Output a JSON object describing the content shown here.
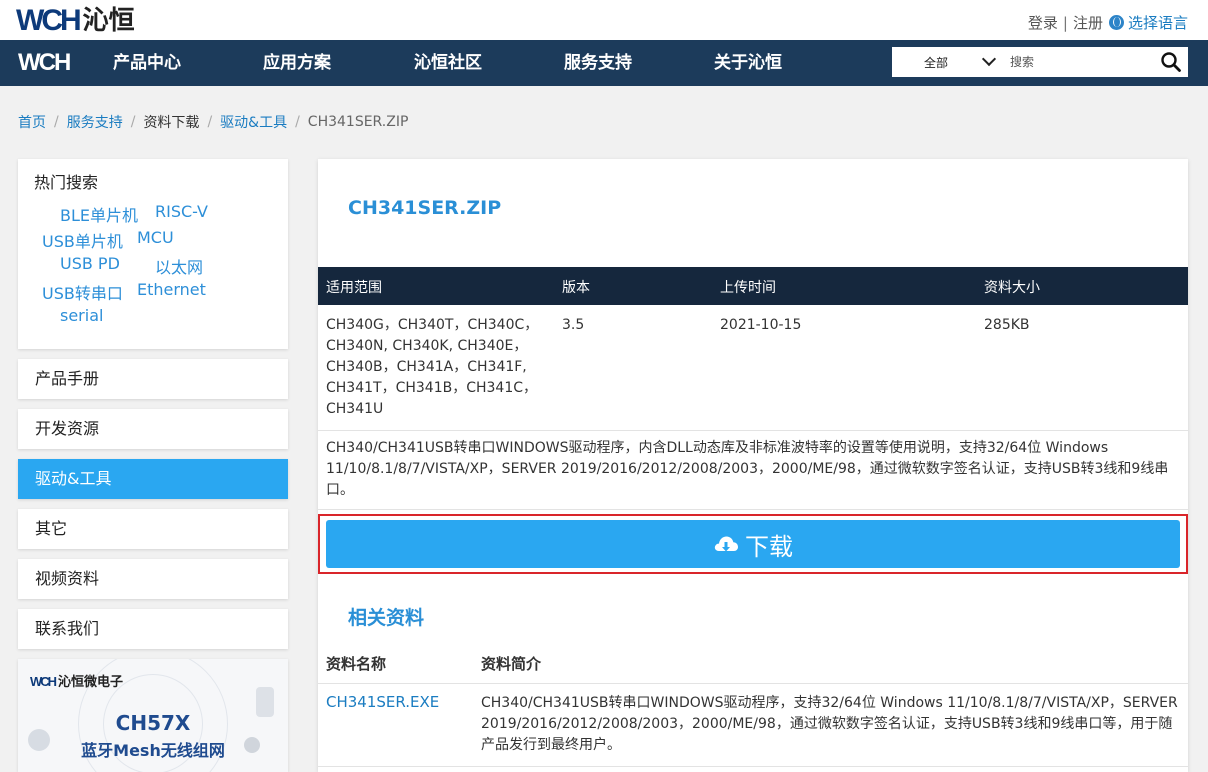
{
  "brand": {
    "logo_mark": "WCH",
    "logo_text": "沁恒"
  },
  "header": {
    "login": "登录",
    "separator": "|",
    "register": "注册",
    "language": "选择语言"
  },
  "nav": {
    "logo_mark": "WCH",
    "items": [
      "产品中心",
      "应用方案",
      "沁恒社区",
      "服务支持",
      "关于沁恒"
    ],
    "search": {
      "scope": "全部",
      "placeholder": "搜索",
      "value": ""
    }
  },
  "breadcrumb": [
    "首页",
    "服务支持",
    "资料下载",
    "驱动&工具",
    "CH341SER.ZIP"
  ],
  "sidebar": {
    "hot_title": "热门搜索",
    "hot_tags": [
      "BLE单片机",
      "RISC-V",
      "USB单片机",
      "MCU",
      "USB PD",
      "以太网",
      "USB转串口",
      "Ethernet",
      "serial"
    ],
    "menu": [
      "产品手册",
      "开发资源",
      "驱动&工具",
      "其它",
      "视频资料",
      "联系我们"
    ],
    "active_index": 2,
    "banner": {
      "brand_mark": "WCH",
      "brand": "沁恒微电子",
      "title": "CH57X",
      "subtitle": "蓝牙Mesh无线组网"
    }
  },
  "document": {
    "title": "CH341SER.ZIP",
    "columns": [
      "适用范围",
      "版本",
      "上传时间",
      "资料大小"
    ],
    "scope_lines": [
      "CH340G，CH340T，CH340C，",
      "CH340N, CH340K, CH340E，",
      "CH340B，CH341A，CH341F,",
      "CH341T，CH341B，CH341C，",
      "CH341U"
    ],
    "version": "3.5",
    "upload_time": "2021-10-15",
    "size": "285KB",
    "description": "CH340/CH341USB转串口WINDOWS驱动程序，内含DLL动态库及非标准波特率的设置等使用说明，支持32/64位 Windows 11/10/8.1/8/7/VISTA/XP，SERVER 2019/2016/2012/2008/2003，2000/ME/98，通过微软数字签名认证，支持USB转3线和9线串口。",
    "download_label": "下载"
  },
  "related": {
    "title": "相关资料",
    "columns": [
      "资料名称",
      "资料简介"
    ],
    "rows": [
      {
        "name": "CH341SER.EXE",
        "desc": "CH340/CH341USB转串口WINDOWS驱动程序，支持32/64位 Windows 11/10/8.1/8/7/VISTA/XP，SERVER 2019/2016/2012/2008/2003，2000/ME/98，通过微软数字签名认证，支持USB转3线和9线串口等，用于随产品发行到最终用户。"
      }
    ]
  },
  "colors": {
    "nav_bg": "#1c3b5b",
    "accent": "#2aa7f1",
    "link": "#1a7cc1",
    "table_head": "#15273d",
    "highlight_border": "#d9252a"
  }
}
